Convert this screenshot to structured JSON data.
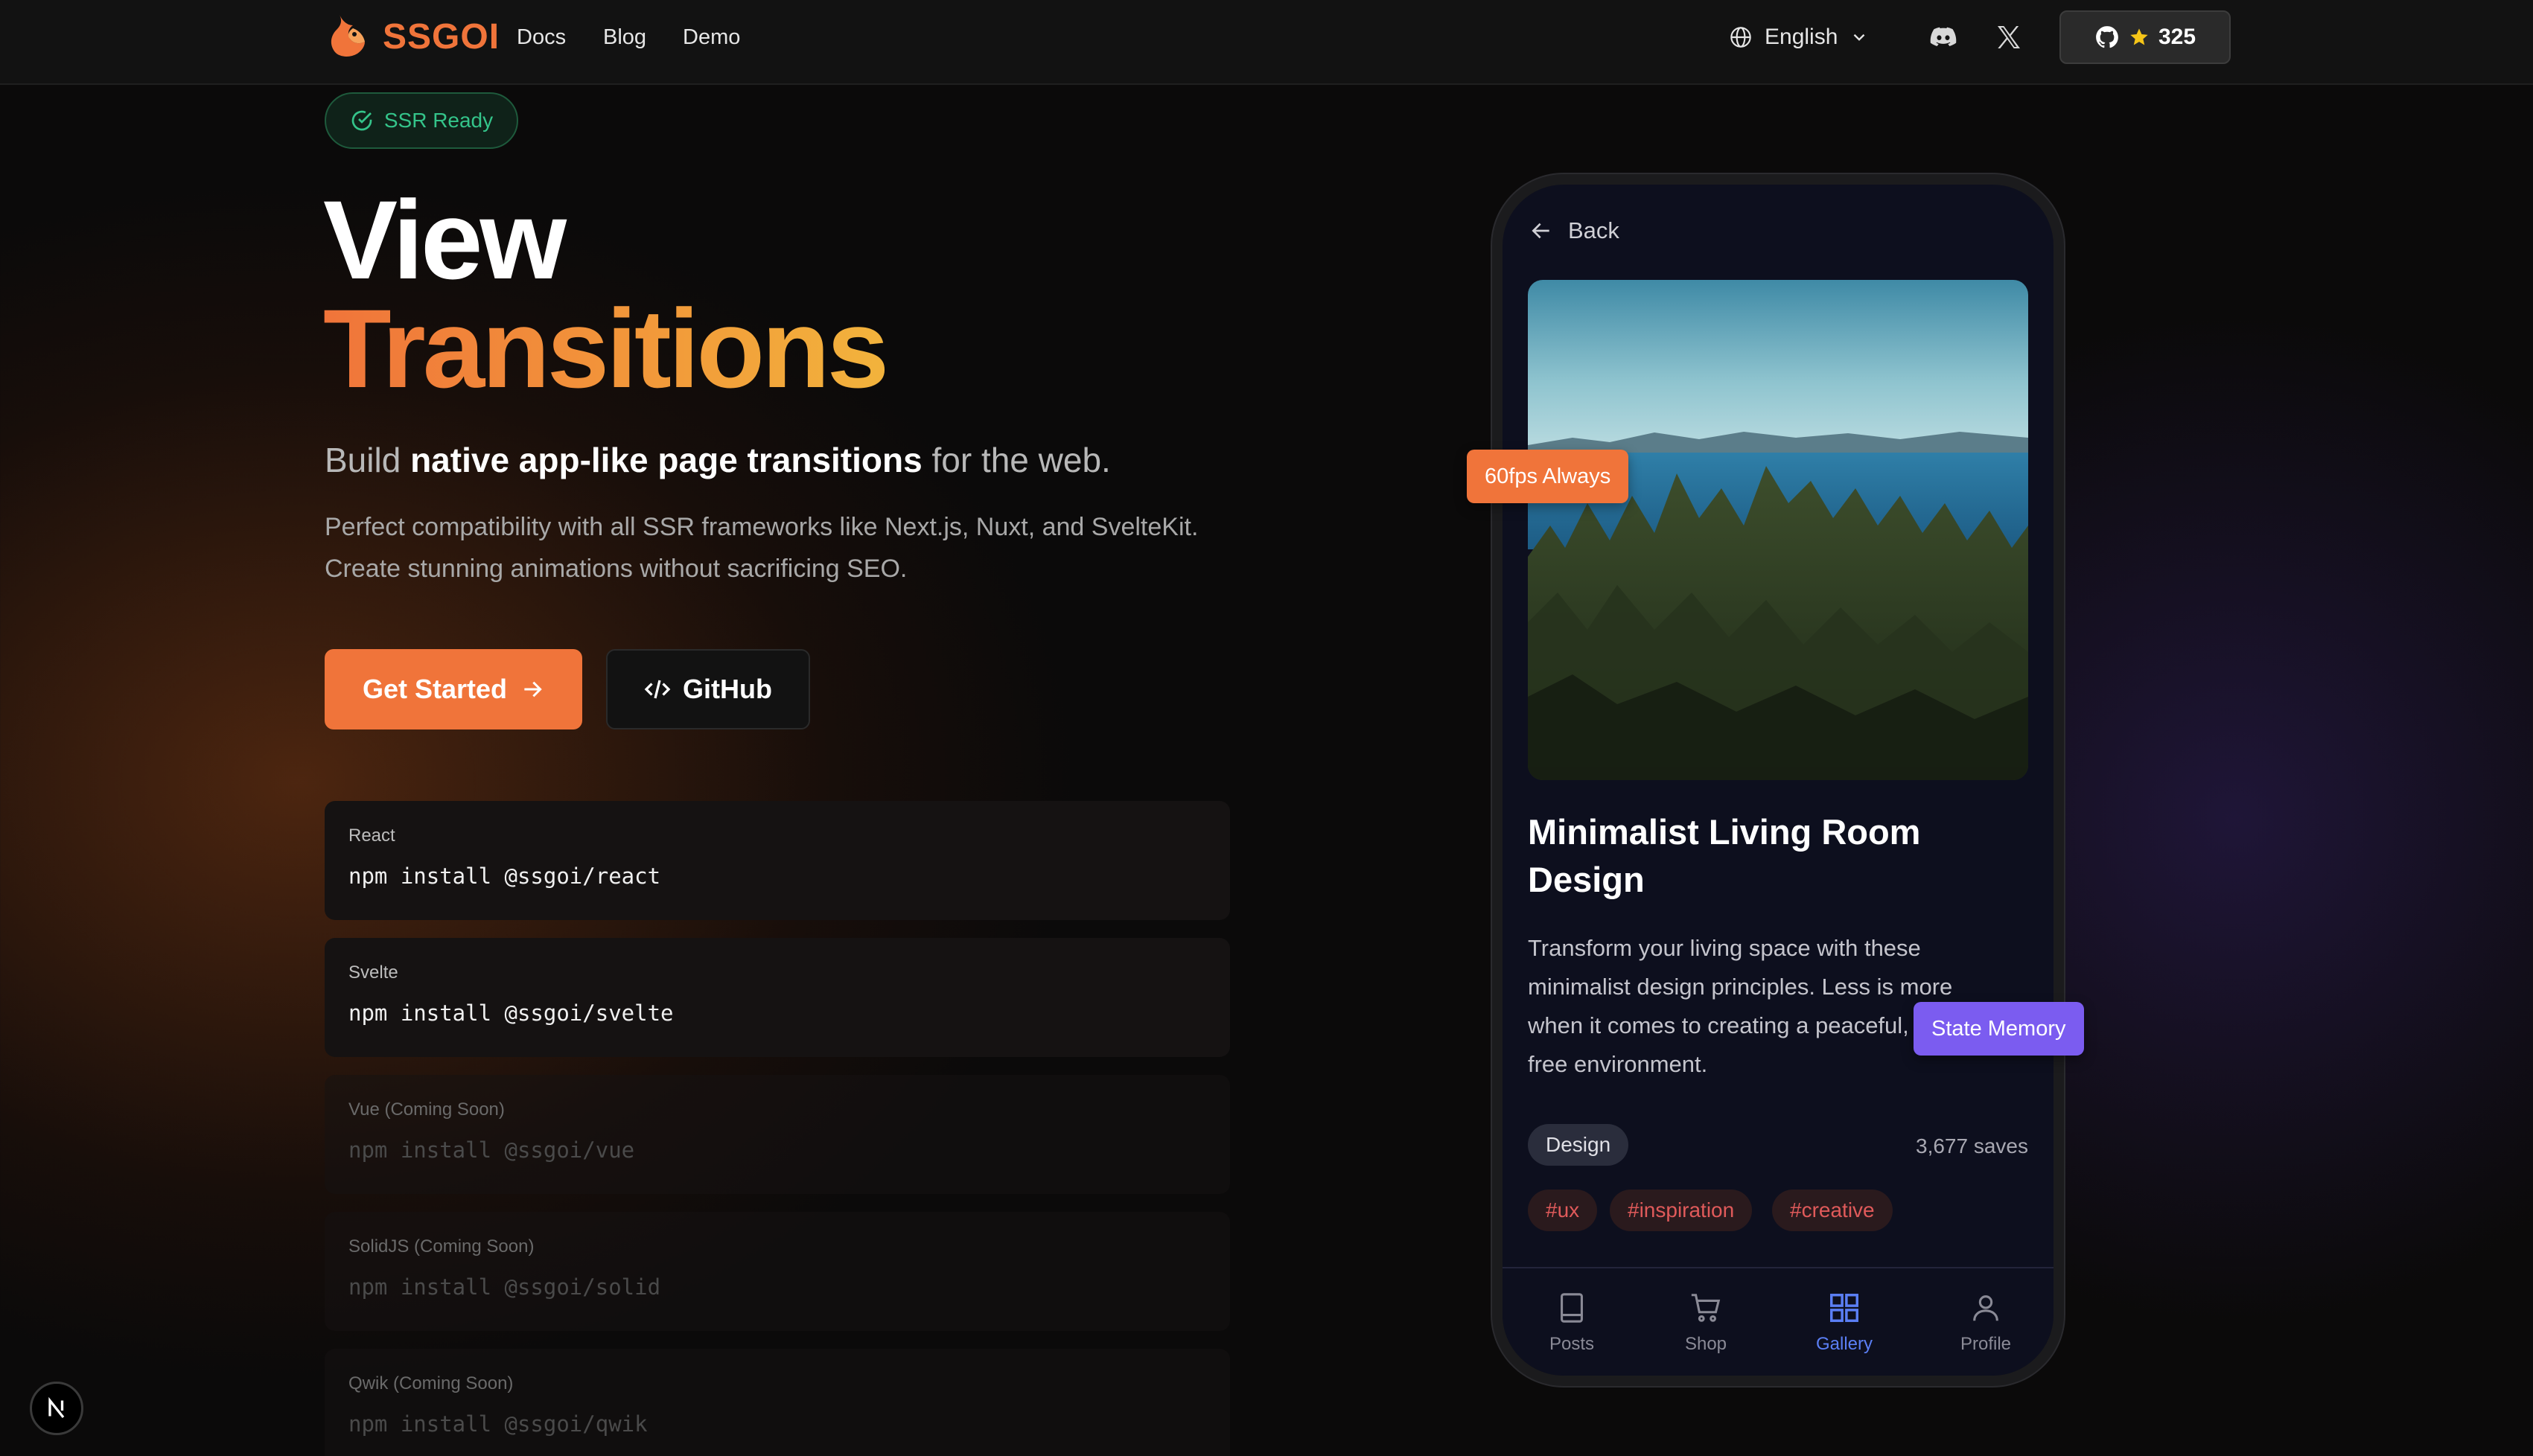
{
  "nav": {
    "brand": "SSGOI",
    "links": [
      "Docs",
      "Blog",
      "Demo"
    ],
    "language": "English",
    "github_stars": "325"
  },
  "hero": {
    "badge": "SSR Ready",
    "title_line1": "View",
    "title_line2": "Transitions",
    "subtitle_pre": "Build ",
    "subtitle_bold": "native app-like page transitions",
    "subtitle_post": " for the web.",
    "description": "Perfect compatibility with all SSR frameworks like Next.js, Nuxt, and SvelteKit. Create stunning animations without sacrificing SEO.",
    "primary_button": "Get Started",
    "secondary_button": "GitHub"
  },
  "installs": [
    {
      "framework": "React",
      "command": "npm install @ssgoi/react",
      "available": true
    },
    {
      "framework": "Svelte",
      "command": "npm install @ssgoi/svelte",
      "available": true
    },
    {
      "framework": "Vue (Coming Soon)",
      "command": "npm install @ssgoi/vue",
      "available": false
    },
    {
      "framework": "SolidJS (Coming Soon)",
      "command": "npm install @ssgoi/solid",
      "available": false
    },
    {
      "framework": "Qwik (Coming Soon)",
      "command": "npm install @ssgoi/qwik",
      "available": false
    }
  ],
  "phone": {
    "back_label": "Back",
    "card_title": "Minimalist Living Room Design",
    "card_description": "Transform your living space with these minimalist design principles. Less is more when it comes to creating a peaceful, clutter-free environment.",
    "category": "Design",
    "saves": "3,677 saves",
    "hashtags": [
      "#ux",
      "#inspiration",
      "#creative"
    ],
    "tabs": [
      {
        "label": "Posts",
        "icon": "book-icon",
        "active": false
      },
      {
        "label": "Shop",
        "icon": "cart-icon",
        "active": false
      },
      {
        "label": "Gallery",
        "icon": "grid-icon",
        "active": true
      },
      {
        "label": "Profile",
        "icon": "user-icon",
        "active": false
      }
    ]
  },
  "floating_pills": {
    "fps": "60fps Always",
    "state": "State Memory"
  },
  "colors": {
    "accent": "#f0743a",
    "success": "#34c48a",
    "purple": "#7b5cf0",
    "active_tab": "#5b7ff5"
  }
}
